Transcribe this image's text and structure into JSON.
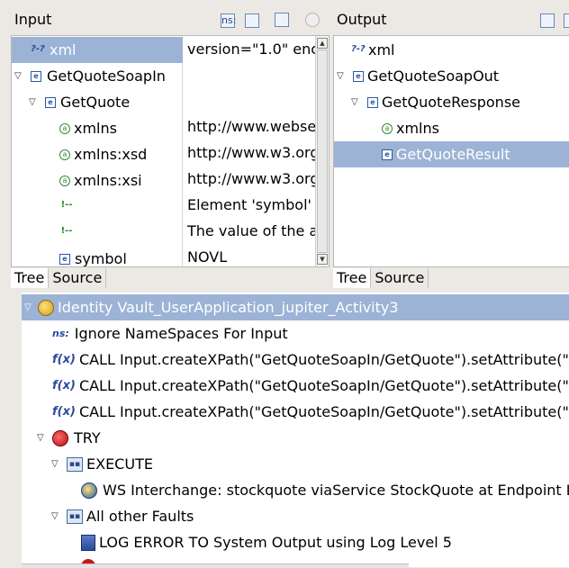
{
  "input_panel": {
    "title": "Input",
    "rows": [
      {
        "name": "xml",
        "value": "version=\"1.0\" enc",
        "icon": "pi-icon"
      },
      {
        "name": "GetQuoteSoapIn",
        "value": "",
        "icon": "element-icon"
      },
      {
        "name": "GetQuote",
        "value": "",
        "icon": "element-icon"
      },
      {
        "name": "xmlns",
        "value": "http://www.webse",
        "icon": "attribute-icon"
      },
      {
        "name": "xmlns:xsd",
        "value": "http://www.w3.org",
        "icon": "attribute-icon"
      },
      {
        "name": "xmlns:xsi",
        "value": "http://www.w3.org",
        "icon": "attribute-icon"
      },
      {
        "name": "",
        "value": "Element 'symbol'",
        "icon": "comment-icon"
      },
      {
        "name": "",
        "value": "The value of the a",
        "icon": "comment-icon"
      },
      {
        "name": "symbol",
        "value": "NOVL",
        "icon": "element-icon"
      }
    ],
    "tabs": [
      "Tree",
      "Source"
    ]
  },
  "output_panel": {
    "title": "Output",
    "rows": [
      {
        "name": "xml",
        "icon": "pi-icon"
      },
      {
        "name": "GetQuoteSoapOut",
        "icon": "element-icon"
      },
      {
        "name": "GetQuoteResponse",
        "icon": "element-icon"
      },
      {
        "name": "xmlns",
        "icon": "attribute-icon"
      },
      {
        "name": "GetQuoteResult",
        "icon": "element-icon"
      }
    ],
    "tabs": [
      "Tree",
      "Source"
    ]
  },
  "icon_glyphs": {
    "pi": "?-?",
    "element": "e",
    "attribute": "a",
    "comment": "!--",
    "fx": "f(x)",
    "ns": "ns:"
  },
  "policy_tree": {
    "root": "Identity Vault_UserApplication_jupiter_Activity3",
    "items": [
      "Ignore NameSpaces For  Input",
      "CALL Input.createXPath(\"GetQuoteSoapIn/GetQuote\").setAttribute(\"x",
      "CALL Input.createXPath(\"GetQuoteSoapIn/GetQuote\").setAttribute(\"x",
      "CALL Input.createXPath(\"GetQuoteSoapIn/GetQuote\").setAttribute(\"x",
      "TRY",
      "EXECUTE",
      "WS Interchange: stockquote viaService StockQuote at Endpoint L",
      "All other Faults",
      "LOG ERROR TO System Output using Log Level 5"
    ]
  },
  "colors": {
    "selection": "#9cb3d5",
    "accent": "#2a4a9a"
  }
}
